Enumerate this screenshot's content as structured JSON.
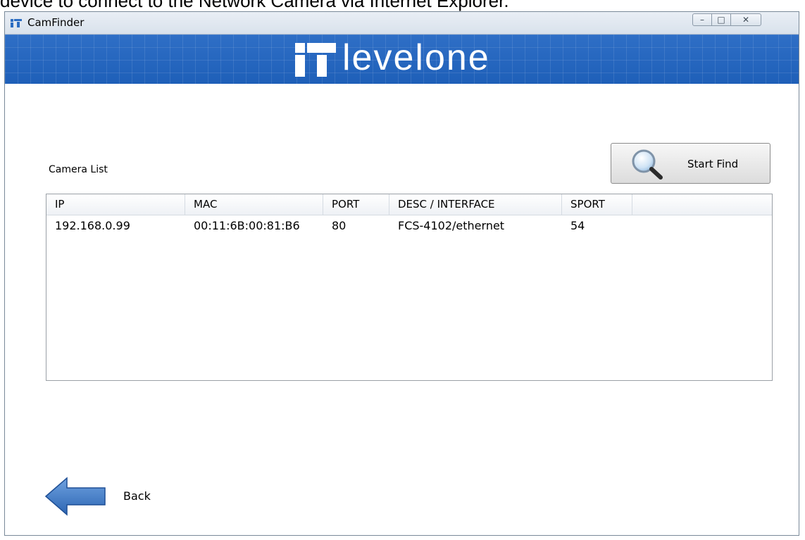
{
  "document": {
    "caption": "device to connect to the Network Camera via Internet Explorer."
  },
  "window": {
    "title": "CamFinder",
    "controls": {
      "minimize": "–",
      "maximize": "□",
      "close": "✕"
    }
  },
  "banner": {
    "brand": "levelone"
  },
  "camera_list": {
    "label": "Camera List",
    "columns": [
      "IP",
      "MAC",
      "PORT",
      "DESC / INTERFACE",
      "SPORT"
    ],
    "rows": [
      [
        "192.168.0.99",
        "00:11:6B:00:81:B6",
        "80",
        "FCS-4102/ethernet",
        "54"
      ]
    ]
  },
  "actions": {
    "start_find": "Start Find",
    "back": "Back"
  },
  "colors": {
    "banner": "#1e5fb8",
    "arrow": "#3a78c9",
    "window_border": "#7a8a99"
  },
  "icons": {
    "app": "levelone-logo-icon",
    "search": "magnifier-icon",
    "back": "left-arrow-icon"
  }
}
